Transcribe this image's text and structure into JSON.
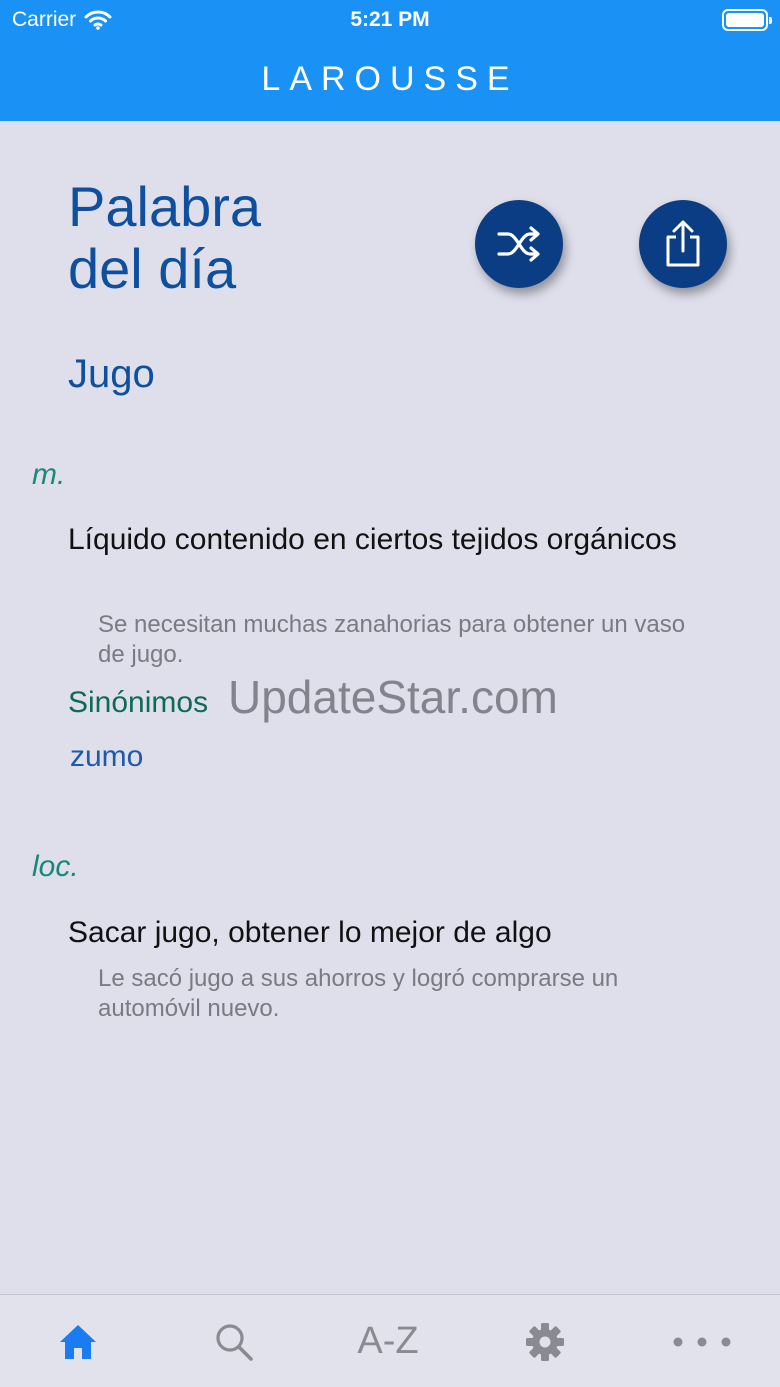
{
  "status_bar": {
    "carrier": "Carrier",
    "time": "5:21 PM"
  },
  "app": {
    "title": "LAROUSSE"
  },
  "page": {
    "title_line1": "Palabra",
    "title_line2": "del día"
  },
  "actions": [
    {
      "name": "shuffle",
      "icon": "shuffle-icon"
    },
    {
      "name": "share",
      "icon": "share-icon"
    }
  ],
  "entry": {
    "headword": "Jugo",
    "senses": [
      {
        "pos": "m.",
        "definition": "Líquido contenido en ciertos tejidos orgánicos",
        "example": "Se necesitan muchas zanahorias para obtener un vaso de jugo.",
        "synonyms_label": "Sinónimos",
        "synonyms": [
          "zumo"
        ]
      },
      {
        "pos": "loc.",
        "definition": "Sacar jugo, obtener lo mejor de algo",
        "example": "Le sacó jugo a sus ahorros y logró comprarse un automóvil nuevo."
      }
    ]
  },
  "watermark": "UpdateStar.com",
  "tab_bar": {
    "active": "home",
    "tabs": [
      {
        "name": "home",
        "icon": "home-icon"
      },
      {
        "name": "search",
        "icon": "search-icon"
      },
      {
        "name": "az",
        "label": "A-Z"
      },
      {
        "name": "settings",
        "icon": "gear-icon"
      },
      {
        "name": "more",
        "icon": "more-icon"
      }
    ]
  },
  "colors": {
    "accent": "#1a92f5",
    "primary_dark": "#0b3d84",
    "background": "#dfdfec",
    "pos": "#19877a",
    "tab_active": "#1a7cf0",
    "tab_inactive": "#8a8a92"
  }
}
